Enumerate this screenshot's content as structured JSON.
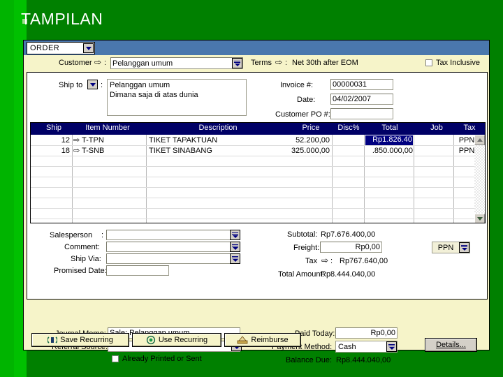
{
  "slide": {
    "title": "TAMPILAN",
    "bullet_icon": "square-bullet"
  },
  "window": {
    "type_selector": {
      "value": "ORDER",
      "icon": "chevron-down-icon"
    }
  },
  "header": {
    "customer_label": "Customer",
    "customer_arrow": "⇨",
    "customer_colon": ":",
    "customer_value": "Pelanggan umum",
    "terms_label": "Terms",
    "terms_arrow": "⇨",
    "terms_colon": ":",
    "terms_value": "Net 30th after EOM",
    "tax_inclusive_label": "Tax Inclusive",
    "tax_inclusive_checked": false
  },
  "shipto": {
    "label": "Ship to",
    "colon": ":",
    "line1": "Pelanggan umum",
    "line2": "Dimana saja di atas dunia"
  },
  "invoice": {
    "invoice_label": "Invoice #:",
    "invoice_value": "00000031",
    "date_label": "Date:",
    "date_value": "04/02/2007",
    "po_label": "Customer PO #:",
    "po_value": ""
  },
  "grid": {
    "columns": [
      "Ship",
      "Item Number",
      "Description",
      "Price",
      "Disc%",
      "Total",
      "Job",
      "Tax"
    ],
    "rows": [
      {
        "ship": "12",
        "item_arrow": "⇨",
        "item": "T-TPN",
        "description": "TIKET TAPAKTUAN",
        "price": "52.200,00",
        "disc": "",
        "total": "Rp1.826.40",
        "total_selected": true,
        "job": "",
        "tax": "PPN"
      },
      {
        "ship": "18",
        "item_arrow": "⇨",
        "item": "T-SNB",
        "description": "TIKET SINABANG",
        "price": "325.000,00",
        "disc": "",
        "total": ".850.000,00",
        "total_selected": false,
        "job": "",
        "tax": "PPN"
      }
    ],
    "scrollbar": {
      "up_icon": "triangle-up-icon",
      "down_icon": "triangle-down-icon"
    }
  },
  "lower_left": {
    "salesperson_label": "Salesperson",
    "salesperson_colon": ":",
    "salesperson_value": "",
    "comment_label": "Comment:",
    "comment_value": "",
    "shipvia_label": "Ship Via:",
    "shipvia_value": "",
    "promised_label": "Promised Date:",
    "promised_value": ""
  },
  "totals": {
    "subtotal_label": "Subtotal:",
    "subtotal_value": "Rp7.676.400,00",
    "freight_label": "Freight:",
    "freight_value": "Rp0,00",
    "tax_label": "Tax",
    "tax_arrow": "⇨",
    "tax_colon": ":",
    "tax_value": "Rp767.640,00",
    "total_label": "Total Amount:",
    "total_value": "Rp8.444.040,00",
    "tax_code": "PPN"
  },
  "footer": {
    "journal_label": "Journal Memo:",
    "journal_value": "Sale; Pelanggan umum",
    "referral_label": "Referral Source:",
    "referral_value": "",
    "printed_label": "Already Printed or Sent",
    "printed_checked": false,
    "paid_label": "Paid Today:",
    "paid_value": "Rp0,00",
    "method_label": "Payment Method:",
    "method_value": "Cash",
    "balance_label": "Balance Due:",
    "balance_value": "Rp8.444.040,00",
    "details_label": "Details..."
  },
  "buttons": {
    "save_recurring": "Save Recurring",
    "use_recurring": "Use Recurring",
    "reimburse": "Reimburse",
    "save_icon": "save-recurring-icon",
    "use_icon": "use-recurring-icon",
    "reimburse_icon": "reimburse-icon"
  },
  "colors": {
    "slide_bg": "#008000",
    "band": "#00c000",
    "titlebar": "#4a77ad",
    "form_bg": "#f6f4c9",
    "grid_header": "#000066",
    "selection": "#000080"
  }
}
